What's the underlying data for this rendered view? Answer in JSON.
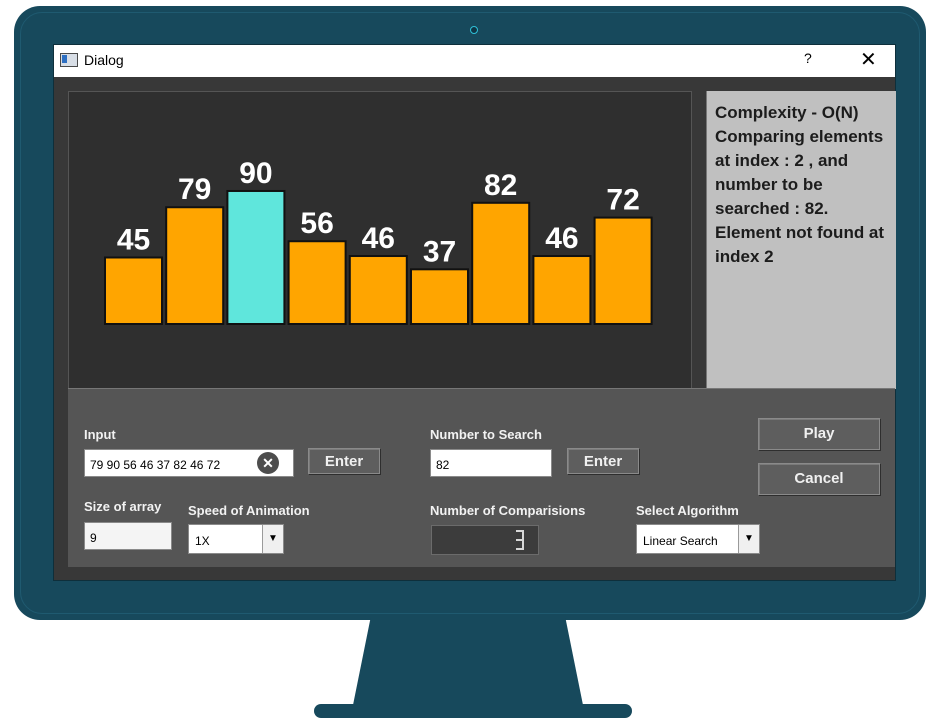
{
  "window": {
    "title": "Dialog",
    "help_glyph": "?",
    "close_glyph": "✕"
  },
  "bars": {
    "values": [
      45,
      79,
      90,
      56,
      46,
      37,
      82,
      46,
      72
    ],
    "highlight_index": 2,
    "bar_color": "#ffa500",
    "highlight_color": "#5fe6dc",
    "label_color": "#ffffff"
  },
  "info": {
    "text": "Complexity - O(N) Comparing elements at index : 2 , and number to be searched : 82. Element not found at index 2"
  },
  "controls": {
    "input_label": "Input",
    "input_value": "79 90 56 46 37 82 46 72",
    "clear_glyph": "✕",
    "input_enter": "Enter",
    "search_label": "Number to Search",
    "search_value": "82",
    "search_enter": "Enter",
    "play": "Play",
    "cancel": "Cancel",
    "size_label": "Size of array",
    "size_value": "9",
    "speed_label": "Speed of Animation",
    "speed_value": "1X",
    "comparisons_label": "Number of Comparisions",
    "algorithm_label": "Select Algorithm",
    "algorithm_value": "Linear Search",
    "dropdown_glyph": "▼"
  },
  "colors": {
    "bezel": "#17495c",
    "canvas": "#2f2f2f",
    "panel": "#555555"
  }
}
